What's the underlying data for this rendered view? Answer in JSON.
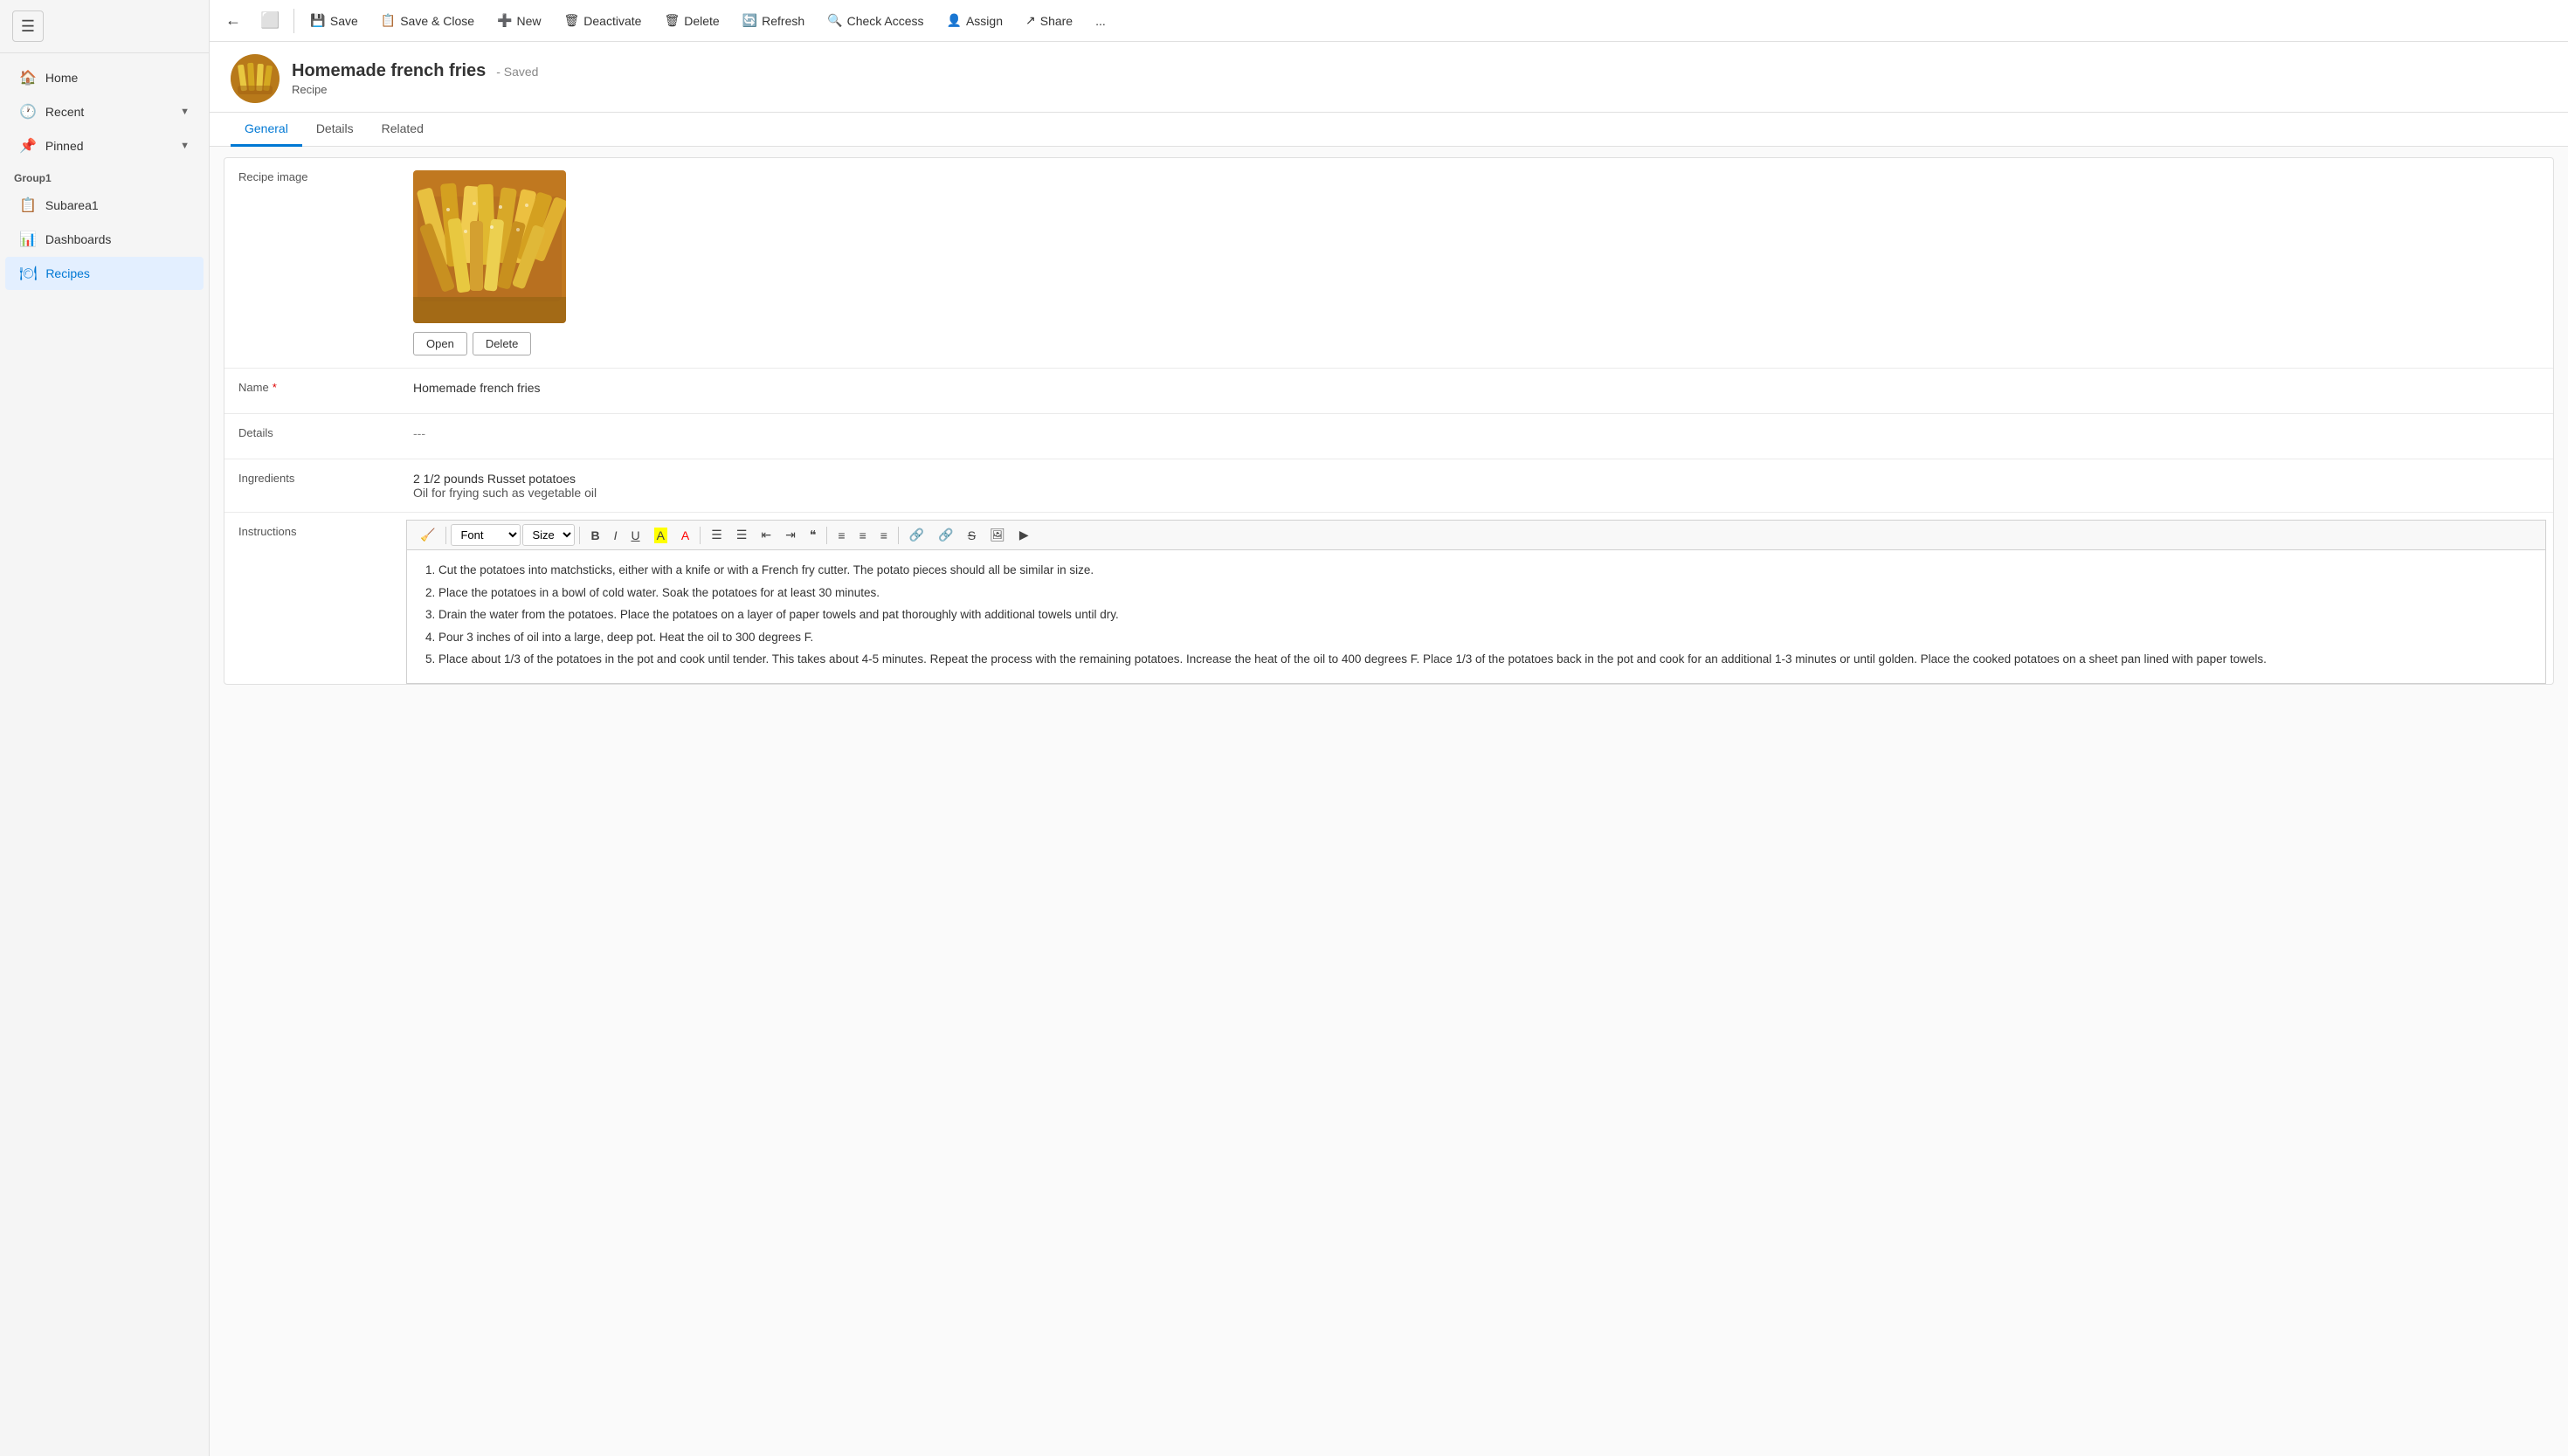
{
  "sidebar": {
    "menu_icon": "☰",
    "items": [
      {
        "id": "home",
        "label": "Home",
        "icon": "🏠",
        "active": false
      },
      {
        "id": "recent",
        "label": "Recent",
        "icon": "🕐",
        "active": false,
        "expandable": true
      },
      {
        "id": "pinned",
        "label": "Pinned",
        "icon": "📌",
        "active": false,
        "expandable": true
      }
    ],
    "group1_label": "Group1",
    "subitems": [
      {
        "id": "subarea1",
        "label": "Subarea1",
        "icon": "📋",
        "active": false
      },
      {
        "id": "dashboards",
        "label": "Dashboards",
        "icon": "📊",
        "active": false
      },
      {
        "id": "recipes",
        "label": "Recipes",
        "icon": "🍽",
        "active": true
      }
    ]
  },
  "toolbar": {
    "back_label": "←",
    "open_label": "⬜",
    "save_label": "Save",
    "save_close_label": "Save & Close",
    "new_label": "New",
    "deactivate_label": "Deactivate",
    "delete_label": "Delete",
    "refresh_label": "Refresh",
    "check_access_label": "Check Access",
    "assign_label": "Assign",
    "share_label": "Share",
    "more_label": "..."
  },
  "record": {
    "title": "Homemade french fries",
    "saved_status": "- Saved",
    "record_type": "Recipe",
    "avatar_emoji": "🍟"
  },
  "tabs": [
    {
      "id": "general",
      "label": "General",
      "active": true
    },
    {
      "id": "details",
      "label": "Details",
      "active": false
    },
    {
      "id": "related",
      "label": "Related",
      "active": false
    }
  ],
  "form": {
    "image_label": "Recipe image",
    "image_open_btn": "Open",
    "image_delete_btn": "Delete",
    "name_label": "Name",
    "name_required": "*",
    "name_value": "Homemade french fries",
    "details_label": "Details",
    "details_value": "---",
    "ingredients_label": "Ingredients",
    "ingredients_line1": "2 1/2 pounds Russet potatoes",
    "ingredients_line2": "Oil for frying such as vegetable oil",
    "instructions_label": "Instructions",
    "rte": {
      "font_label": "Font",
      "size_label": "Size",
      "bold": "B",
      "italic": "I",
      "underline": "U",
      "highlight": "A",
      "font_color": "A",
      "bullet_list": "☰",
      "numbered_list": "☰",
      "indent_less": "←",
      "indent_more": "→",
      "quote": "❝",
      "align_left": "≡",
      "align_center": "≡",
      "align_right": "≡",
      "link": "🔗",
      "unlink": "🔗",
      "strikethrough": "S",
      "image": "🖼",
      "more": "▶"
    },
    "instructions": [
      "Cut the potatoes into matchsticks, either with a knife or with a French fry cutter. The potato pieces should all be similar in size.",
      "Place the potatoes in a bowl of cold water. Soak the potatoes for at least 30 minutes.",
      "Drain the water from the potatoes. Place the potatoes on a layer of paper towels and pat thoroughly with additional towels until dry.",
      "Pour 3 inches of oil into a large, deep pot. Heat the oil to 300 degrees F.",
      "Place about 1/3 of the potatoes in the pot and cook until tender. This takes about 4-5 minutes. Repeat the process with the remaining potatoes. Increase the heat of the oil to 400 degrees F. Place 1/3 of the potatoes back in the pot and cook for an additional 1-3 minutes or until golden. Place the cooked potatoes on a sheet pan lined with paper towels."
    ]
  }
}
